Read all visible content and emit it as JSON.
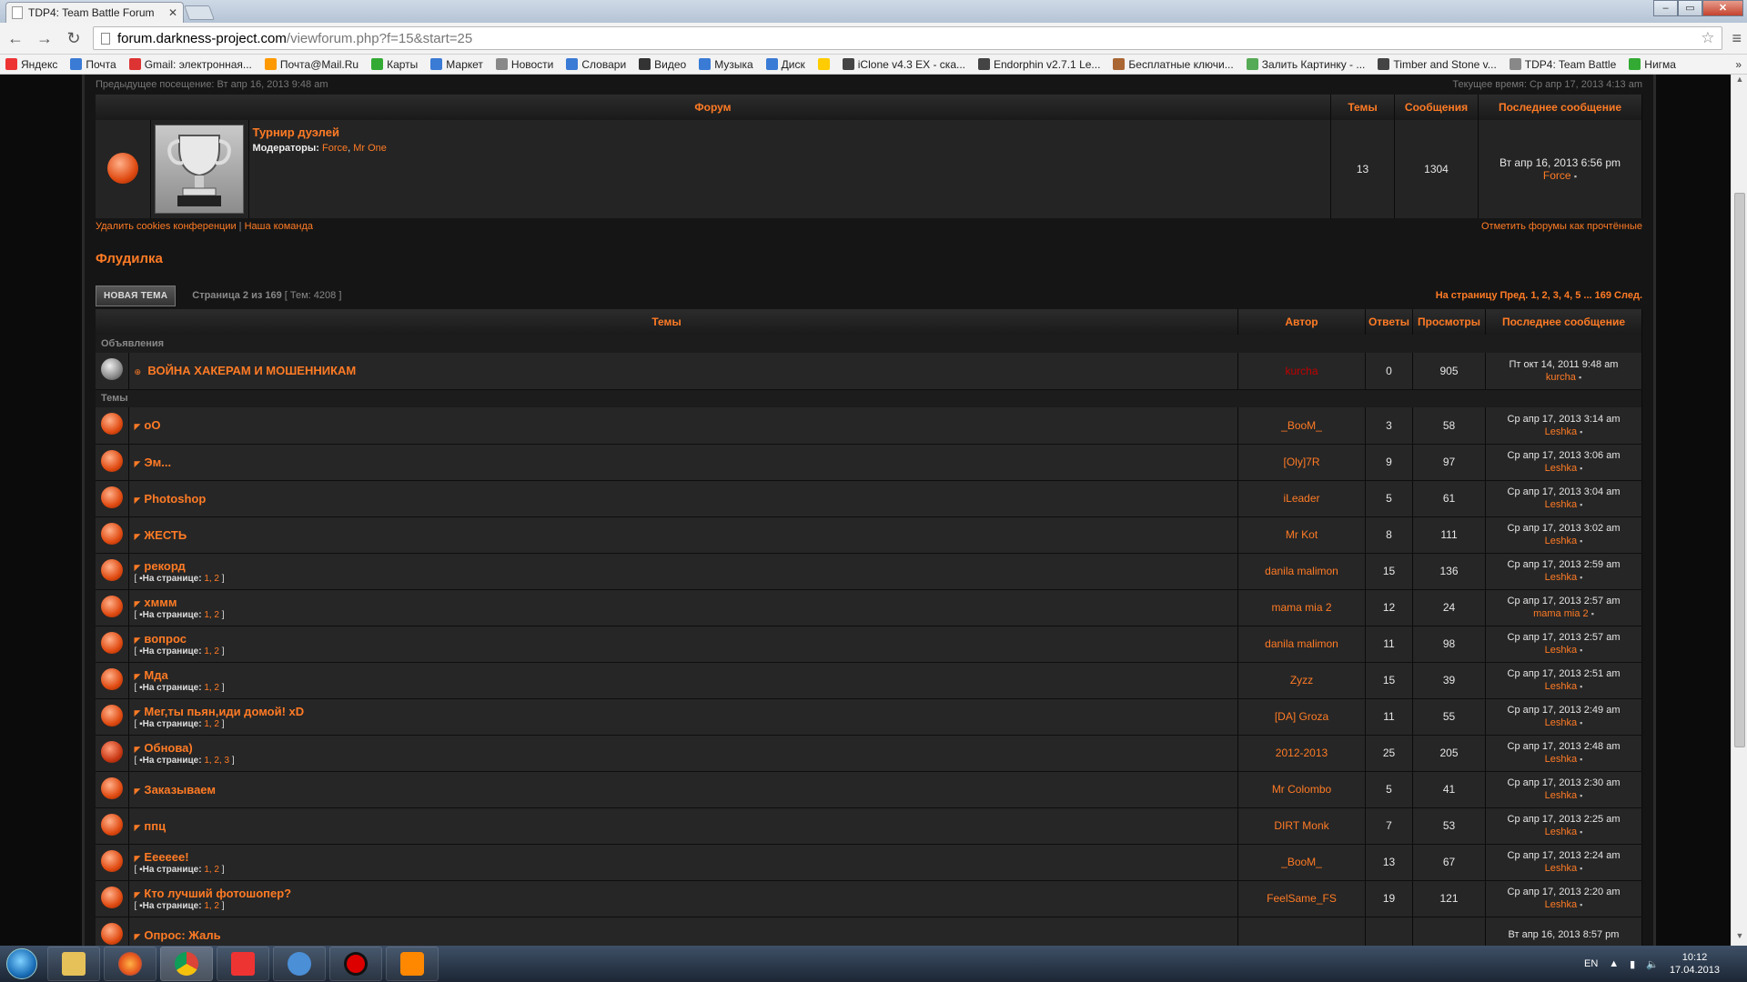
{
  "browser": {
    "tab_title": "TDP4: Team Battle Forum",
    "url_host": "forum.darkness-project.com",
    "url_path": "/viewforum.php?f=15&start=25",
    "bookmarks": [
      {
        "label": "Яндекс",
        "color": "#e33"
      },
      {
        "label": "Почта",
        "color": "#3a7bd5"
      },
      {
        "label": "Gmail: электронная...",
        "color": "#d33"
      },
      {
        "label": "Почта@Mail.Ru",
        "color": "#f90"
      },
      {
        "label": "Карты",
        "color": "#3a3"
      },
      {
        "label": "Маркет",
        "color": "#3a7bd5"
      },
      {
        "label": "Новости",
        "color": "#888"
      },
      {
        "label": "Словари",
        "color": "#3a7bd5"
      },
      {
        "label": "Видео",
        "color": "#333"
      },
      {
        "label": "Музыка",
        "color": "#3a7bd5"
      },
      {
        "label": "Диск",
        "color": "#3a7bd5"
      },
      {
        "label": "",
        "color": "#fc0"
      },
      {
        "label": "iClone v4.3 EX - ска...",
        "color": "#444"
      },
      {
        "label": "Endorphin v2.7.1 Le...",
        "color": "#444"
      },
      {
        "label": "Бесплатные ключи...",
        "color": "#a63"
      },
      {
        "label": "Залить Картинку - ...",
        "color": "#5a5"
      },
      {
        "label": "Timber and Stone v...",
        "color": "#444"
      },
      {
        "label": "TDP4: Team Battle",
        "color": "#888"
      },
      {
        "label": "Нигма",
        "color": "#3a3"
      }
    ],
    "more": "»"
  },
  "header": {
    "prev_visit": "Предыдущее посещение: Вт апр 16, 2013 9:48 am",
    "current_time": "Текущее время: Ср апр 17, 2013 4:13 am"
  },
  "forum_table": {
    "headers": {
      "forum": "Форум",
      "topics": "Темы",
      "posts": "Сообщения",
      "last": "Последнее сообщение"
    },
    "row": {
      "title": "Турнир дуэлей",
      "mods_label": "Модераторы:",
      "mod1": "Force",
      "mod2": "Mr One",
      "topics": "13",
      "posts": "1304",
      "last_date": "Вт апр 16, 2013 6:56 pm",
      "last_by": "Force"
    }
  },
  "links": {
    "delete_cookies": "Удалить cookies конференции",
    "team": "Наша команда",
    "mark_read": "Отметить форумы как прочтённые"
  },
  "section": {
    "title": "Флудилка",
    "new_topic": "НОВАЯ ТЕМА",
    "page_info": "Страница 2 из 169",
    "topic_count": "[ Тем: 4208 ]",
    "pagination": "На страницу Пред. 1, 2, 3, 4, 5 ... 169 След."
  },
  "topics_table": {
    "headers": {
      "topics": "Темы",
      "author": "Автор",
      "replies": "Ответы",
      "views": "Просмотры",
      "last": "Последнее сообщение"
    },
    "cat_announcements": "Объявления",
    "cat_topics": "Темы",
    "announcement": {
      "title": "ВОЙНА ХАКЕРАМ И МОШЕННИКАМ",
      "author": "kurcha",
      "replies": "0",
      "views": "905",
      "last_date": "Пт окт 14, 2011 9:48 am",
      "last_by": "kurcha"
    },
    "pages_label": "На странице:",
    "rows": [
      {
        "title": "oO",
        "pages": "",
        "author": "_BooM_",
        "replies": "3",
        "views": "58",
        "last_date": "Ср апр 17, 2013 3:14 am",
        "last_by": "Leshka"
      },
      {
        "title": "Эм...",
        "pages": "",
        "author": "[Oly]7R",
        "replies": "9",
        "views": "97",
        "last_date": "Ср апр 17, 2013 3:06 am",
        "last_by": "Leshka"
      },
      {
        "title": "Photoshop",
        "pages": "",
        "author": "iLeader",
        "replies": "5",
        "views": "61",
        "last_date": "Ср апр 17, 2013 3:04 am",
        "last_by": "Leshka"
      },
      {
        "title": "ЖЕСТЬ",
        "pages": "",
        "author": "Mr Kot",
        "replies": "8",
        "views": "111",
        "last_date": "Ср апр 17, 2013 3:02 am",
        "last_by": "Leshka"
      },
      {
        "title": "рекорд",
        "pages": "1, 2",
        "author": "danila malimon",
        "replies": "15",
        "views": "136",
        "last_date": "Ср апр 17, 2013 2:59 am",
        "last_by": "Leshka"
      },
      {
        "title": "хммм",
        "pages": "1, 2",
        "author": "mama mia 2",
        "replies": "12",
        "views": "24",
        "last_date": "Ср апр 17, 2013 2:57 am",
        "last_by": "mama mia 2"
      },
      {
        "title": "вопрос",
        "pages": "1, 2",
        "author": "danila malimon",
        "replies": "11",
        "views": "98",
        "last_date": "Ср апр 17, 2013 2:57 am",
        "last_by": "Leshka"
      },
      {
        "title": "Мда",
        "pages": "1, 2",
        "author": "Zyzz",
        "replies": "15",
        "views": "39",
        "last_date": "Ср апр 17, 2013 2:51 am",
        "last_by": "Leshka"
      },
      {
        "title": "Мег,ты пьян,иди домой! xD",
        "pages": "1, 2",
        "author": "[DA] Groza",
        "replies": "11",
        "views": "55",
        "last_date": "Ср апр 17, 2013 2:49 am",
        "last_by": "Leshka"
      },
      {
        "title": "Обнова)",
        "pages": "1, 2, 3",
        "author": "2012-2013",
        "replies": "25",
        "views": "205",
        "last_date": "Ср апр 17, 2013 2:48 am",
        "last_by": "Leshka"
      },
      {
        "title": "Заказываем",
        "pages": "",
        "author": "Mr Colombo",
        "replies": "5",
        "views": "41",
        "last_date": "Ср апр 17, 2013 2:30 am",
        "last_by": "Leshka"
      },
      {
        "title": "ппц",
        "pages": "",
        "author": "DIRT Monk",
        "replies": "7",
        "views": "53",
        "last_date": "Ср апр 17, 2013 2:25 am",
        "last_by": "Leshka"
      },
      {
        "title": "Ееееее!",
        "pages": "1, 2",
        "author": "_BooM_",
        "replies": "13",
        "views": "67",
        "last_date": "Ср апр 17, 2013 2:24 am",
        "last_by": "Leshka"
      },
      {
        "title": "Кто лучший фотошопер?",
        "pages": "1, 2",
        "author": "FeelSame_FS",
        "replies": "19",
        "views": "121",
        "last_date": "Ср апр 17, 2013 2:20 am",
        "last_by": "Leshka"
      },
      {
        "title": "Опрос: Жаль",
        "pages": "",
        "author": "",
        "replies": "",
        "views": "",
        "last_date": "Вт апр 16, 2013 8:57 pm",
        "last_by": ""
      }
    ]
  },
  "taskbar": {
    "lang": "EN",
    "time": "10:12",
    "date": "17.04.2013"
  },
  "colors": {
    "accent": "#ff7b25",
    "background": "#151515",
    "admin_red": "#c20000"
  }
}
